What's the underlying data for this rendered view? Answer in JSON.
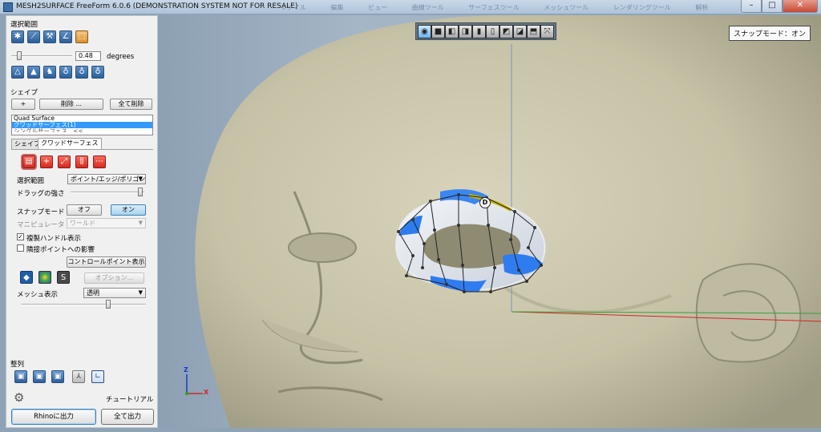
{
  "window": {
    "title": "MESH2SURFACE FreeForm 6.0.6 (DEMONSTRATION SYSTEM NOT FOR RESALE)",
    "menus": [
      "ファイル",
      "編集",
      "ビュー",
      "曲線ツール",
      "サーフェスツール",
      "メッシュツール",
      "レンダリングツール",
      "解析"
    ],
    "min_icon": "minimize-icon",
    "max_icon": "maximize-icon",
    "close_icon": "close-icon"
  },
  "panel": {
    "selection_title": "選択範囲",
    "selection_tools": [
      "select-point-icon",
      "select-edge-icon",
      "select-face-icon",
      "select-curve-icon",
      "select-all-icon"
    ],
    "angle_value": "0.48",
    "angle_unit": "degrees",
    "view_tools": [
      "triangle-outline-icon",
      "triangle-filled-icon",
      "puppet-icon",
      "bulb-a-icon",
      "bulb-b-icon",
      "bulb-c-icon"
    ],
    "shape_title": "シェイプ",
    "add_label": "+",
    "delete_label": "削除 ...",
    "delete_all_label": "全て削除",
    "shape_list": [
      "Quad Surface",
      "クワッドサーフェス(1)",
      "シングルサーフェス...<<"
    ],
    "tabs": [
      "シェイプ",
      "クワッドサーフェス"
    ],
    "quad_tools": [
      "brush-icon",
      "plus-icon",
      "diagonal-icon",
      "columns-icon",
      "dots-icon"
    ],
    "selection_mode_label": "選択範囲",
    "selection_mode_value": "ポイント/エッジ/ポリゴン",
    "drag_strength_label": "ドラッグの強さ",
    "snap_mode_label": "スナップモード",
    "snap_off": "オフ",
    "snap_on": "オン",
    "manipulator_label": "マニピュレータ",
    "manipulator_value": "ワールド",
    "mirror_handles_label": "複製ハンドル表示",
    "mirror_handles_checked": true,
    "neighbor_influence_label": "隣接ポイントへの影響",
    "neighbor_influence_checked": false,
    "show_control_points": "コントロールポイント表示",
    "render_icons": [
      "shade-icon",
      "zebra-icon",
      "rhino-icon"
    ],
    "options_label": "オプション...",
    "mesh_display_label": "メッシュ表示",
    "mesh_display_value": "透明",
    "align_title": "整列",
    "align_tools": [
      "view-front-icon",
      "view-side-icon",
      "view-top-icon",
      "view-persp-icon",
      "view-corner-icon"
    ],
    "settings_icon": "gear-icon",
    "tutorial_label": "チュートリアル",
    "export_rhino": "Rhinoに出力",
    "export_all": "全て出力"
  },
  "viewport": {
    "view_buttons": [
      "zoom-icon",
      "view-1-icon",
      "view-2-icon",
      "view-3-icon",
      "view-4-icon",
      "view-5-icon",
      "view-6-icon",
      "view-7-icon",
      "view-8-icon",
      "view-9-icon"
    ],
    "snap_badge": "スナップモード：オン",
    "control_point_letter": "D",
    "axis_z": "Z",
    "axis_x": "X",
    "colors": {
      "head": "#c9c5ac",
      "surface_white": "#eef1f4",
      "surface_blue": "#2e7cf0",
      "selected_edge": "#c9b400"
    }
  }
}
